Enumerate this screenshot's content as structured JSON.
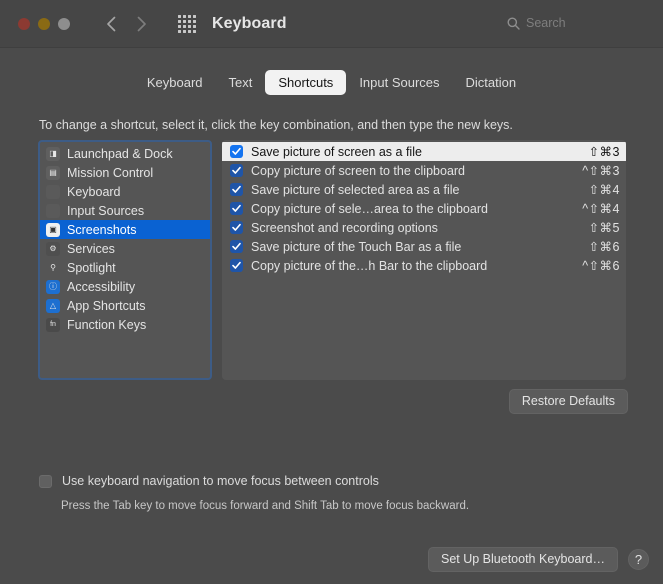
{
  "window": {
    "title": "Keyboard",
    "traffic_lights": [
      "close-button",
      "minimize-button",
      "zoom-button"
    ],
    "back_label": "‹",
    "forward_label": "›",
    "grid_icon": "show-all-icon"
  },
  "search": {
    "placeholder": "Search",
    "value": "",
    "icon": "search-icon"
  },
  "tabs": [
    {
      "label": "Keyboard",
      "active": false
    },
    {
      "label": "Text",
      "active": false
    },
    {
      "label": "Shortcuts",
      "active": true
    },
    {
      "label": "Input Sources",
      "active": false
    },
    {
      "label": "Dictation",
      "active": false
    }
  ],
  "instruction": "To change a shortcut, select it, click the key combination, and then type the new keys.",
  "sidebar": {
    "items": [
      {
        "label": "Launchpad & Dock",
        "icon": "launchpad",
        "glyph": "◨",
        "selected": false
      },
      {
        "label": "Mission Control",
        "icon": "mission",
        "glyph": "▤",
        "selected": false
      },
      {
        "label": "Keyboard",
        "icon": "keyboard",
        "glyph": "",
        "selected": false
      },
      {
        "label": "Input Sources",
        "icon": "inputsrc",
        "glyph": "",
        "selected": false
      },
      {
        "label": "Screenshots",
        "icon": "screenshots",
        "glyph": "▣",
        "selected": true
      },
      {
        "label": "Services",
        "icon": "services",
        "glyph": "⚙",
        "selected": false
      },
      {
        "label": "Spotlight",
        "icon": "spotlight",
        "glyph": "⚲",
        "selected": false
      },
      {
        "label": "Accessibility",
        "icon": "accessibility",
        "glyph": "ⓘ",
        "selected": false
      },
      {
        "label": "App Shortcuts",
        "icon": "appshort",
        "glyph": "△",
        "selected": false
      },
      {
        "label": "Function Keys",
        "icon": "fnkeys",
        "glyph": "fn",
        "selected": false
      }
    ]
  },
  "shortcuts": {
    "rows": [
      {
        "name": "Save picture of screen as a file",
        "keys": "⇧⌘3",
        "checked": true,
        "selected": true
      },
      {
        "name": "Copy picture of screen to the clipboard",
        "keys": "^⇧⌘3",
        "checked": true,
        "selected": false
      },
      {
        "name": "Save picture of selected area as a file",
        "keys": "⇧⌘4",
        "checked": true,
        "selected": false
      },
      {
        "name": "Copy picture of sele…area to the clipboard",
        "keys": "^⇧⌘4",
        "checked": true,
        "selected": false
      },
      {
        "name": "Screenshot and recording options",
        "keys": "⇧⌘5",
        "checked": true,
        "selected": false
      },
      {
        "name": "Save picture of the Touch Bar as a file",
        "keys": "⇧⌘6",
        "checked": true,
        "selected": false
      },
      {
        "name": "Copy picture of the…h Bar to the clipboard",
        "keys": "^⇧⌘6",
        "checked": true,
        "selected": false
      }
    ]
  },
  "buttons": {
    "restore_defaults": "Restore Defaults",
    "set_up_bluetooth": "Set Up Bluetooth Keyboard…",
    "help": "?"
  },
  "keyboard_nav": {
    "label": "Use keyboard navigation to move focus between controls",
    "checked": false,
    "hint": "Press the Tab key to move focus forward and Shift Tab to move focus backward."
  },
  "colors": {
    "background": "#4b4b4b",
    "titlebar": "#464646",
    "panel": "#555555",
    "selection_blue": "#0a62d2",
    "checkbox_blue": "#1f55a8",
    "focus_ring": "#3d5c86",
    "row_selected": "#ededed"
  }
}
